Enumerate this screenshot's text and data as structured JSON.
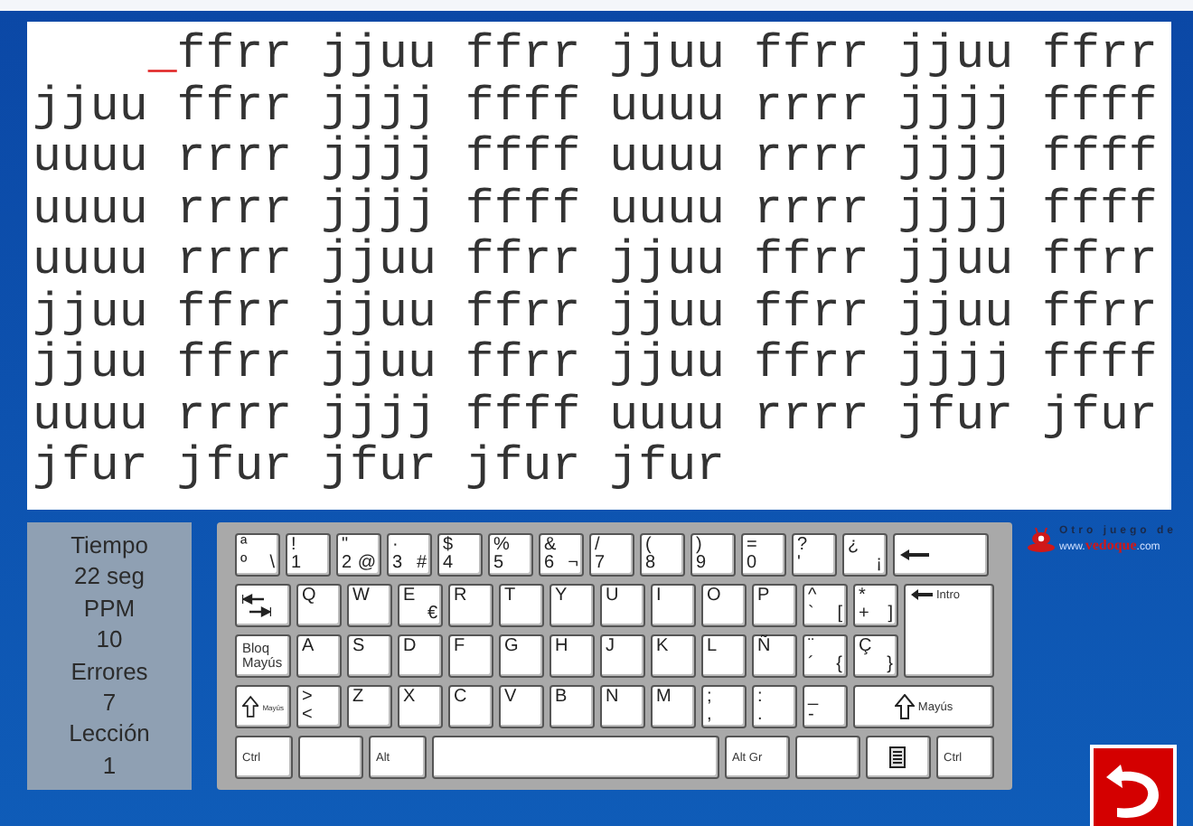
{
  "typing_area": {
    "cursor": "_",
    "lines": [
      "ffrr jjuu ffrr jjuu ffrr jjuu ffrr",
      "jjuu ffrr jjjj ffff uuuu rrrr jjjj ffff",
      "uuuu rrrr jjjj ffff uuuu rrrr jjjj ffff",
      "uuuu rrrr jjjj ffff uuuu rrrr jjjj ffff",
      "uuuu rrrr jjuu ffrr jjuu ffrr jjuu ffrr",
      "jjuu ffrr jjuu ffrr jjuu ffrr jjuu ffrr",
      "jjuu ffrr jjuu ffrr jjuu ffrr jjjj ffff",
      "uuuu rrrr jjjj ffff uuuu rrrr jfur jfur",
      "jfur jfur jfur jfur jfur"
    ]
  },
  "stats": [
    {
      "label": "Tiempo",
      "value": "22 seg"
    },
    {
      "label": "PPM",
      "value": "10"
    },
    {
      "label": "Errores",
      "value": "7"
    },
    {
      "label": "Lección",
      "value": "1"
    }
  ],
  "keyboard": {
    "enter_key": {
      "kind": "enter",
      "label": "Intro"
    },
    "rows": [
      {
        "keys": [
          {
            "kind": "key",
            "tl": "ª",
            "bl": "º",
            "br": "\\"
          },
          {
            "kind": "key",
            "tl": "!",
            "bl": "1"
          },
          {
            "kind": "key",
            "tl": "\"",
            "bl": "2",
            "br": "@"
          },
          {
            "kind": "key",
            "tl": "·",
            "bl": "3",
            "br": "#"
          },
          {
            "kind": "key",
            "tl": "$",
            "bl": "4"
          },
          {
            "kind": "key",
            "tl": "%",
            "bl": "5"
          },
          {
            "kind": "key",
            "tl": "&",
            "bl": "6",
            "br": "¬"
          },
          {
            "kind": "key",
            "tl": "/",
            "bl": "7"
          },
          {
            "kind": "key",
            "tl": "(",
            "bl": "8"
          },
          {
            "kind": "key",
            "tl": ")",
            "bl": "9"
          },
          {
            "kind": "key",
            "tl": "=",
            "bl": "0"
          },
          {
            "kind": "key",
            "tl": "?",
            "bl": "'"
          },
          {
            "kind": "key",
            "tl": "¿",
            "br": "¡"
          },
          {
            "kind": "backspace"
          }
        ]
      },
      {
        "keys": [
          {
            "kind": "tab"
          },
          {
            "kind": "key",
            "tl": "Q"
          },
          {
            "kind": "key",
            "tl": "W"
          },
          {
            "kind": "key",
            "tl": "E",
            "br": "€"
          },
          {
            "kind": "key",
            "tl": "R"
          },
          {
            "kind": "key",
            "tl": "T"
          },
          {
            "kind": "key",
            "tl": "Y"
          },
          {
            "kind": "key",
            "tl": "U"
          },
          {
            "kind": "key",
            "tl": "I"
          },
          {
            "kind": "key",
            "tl": "O"
          },
          {
            "kind": "key",
            "tl": "P"
          },
          {
            "kind": "key",
            "tl": "^",
            "bl": "`",
            "br": "["
          },
          {
            "kind": "key",
            "tl": "*",
            "bl": "+",
            "br": "]"
          }
        ]
      },
      {
        "keys": [
          {
            "kind": "caps",
            "label": "Bloq Mayús"
          },
          {
            "kind": "key",
            "tl": "A"
          },
          {
            "kind": "key",
            "tl": "S"
          },
          {
            "kind": "key",
            "tl": "D"
          },
          {
            "kind": "key",
            "tl": "F"
          },
          {
            "kind": "key",
            "tl": "G"
          },
          {
            "kind": "key",
            "tl": "H"
          },
          {
            "kind": "key",
            "tl": "J"
          },
          {
            "kind": "key",
            "tl": "K"
          },
          {
            "kind": "key",
            "tl": "L"
          },
          {
            "kind": "key",
            "tl": "Ñ"
          },
          {
            "kind": "key",
            "tl": "¨",
            "bl": "´",
            "br": "{"
          },
          {
            "kind": "key",
            "tl": "Ç",
            "br": "}"
          }
        ]
      },
      {
        "keys": [
          {
            "kind": "shift",
            "label": "Mayús"
          },
          {
            "kind": "key",
            "tl": ">",
            "bl": "<"
          },
          {
            "kind": "key",
            "tl": "Z"
          },
          {
            "kind": "key",
            "tl": "X"
          },
          {
            "kind": "key",
            "tl": "C"
          },
          {
            "kind": "key",
            "tl": "V"
          },
          {
            "kind": "key",
            "tl": "B"
          },
          {
            "kind": "key",
            "tl": "N"
          },
          {
            "kind": "key",
            "tl": "M"
          },
          {
            "kind": "key",
            "tl": ";",
            "bl": ","
          },
          {
            "kind": "key",
            "tl": ":",
            "bl": "."
          },
          {
            "kind": "key",
            "tl": "_",
            "bl": "-"
          },
          {
            "kind": "shiftwide",
            "label": "Mayús"
          }
        ]
      },
      {
        "keys": [
          {
            "kind": "mod",
            "label": "Ctrl"
          },
          {
            "kind": "blank"
          },
          {
            "kind": "mod",
            "label": "Alt"
          },
          {
            "kind": "space"
          },
          {
            "kind": "modwide",
            "label": "Alt Gr"
          },
          {
            "kind": "blank"
          },
          {
            "kind": "menu"
          },
          {
            "kind": "mod",
            "label": "Ctrl"
          }
        ]
      }
    ]
  },
  "logo": {
    "tagline": "Otro juego de",
    "url_prefix": "www.",
    "url_name": "vedoque",
    "url_suffix": ".com"
  }
}
